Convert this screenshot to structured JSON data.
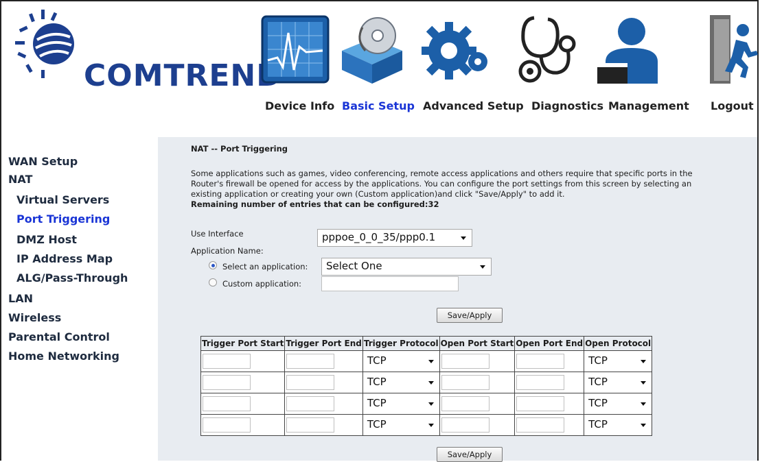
{
  "brand": {
    "name": "COMTREND"
  },
  "nav": {
    "items": [
      {
        "label": "Device Info",
        "icon": "device-info-icon"
      },
      {
        "label": "Basic Setup",
        "icon": "basic-setup-icon",
        "active": true
      },
      {
        "label": "Advanced Setup",
        "icon": "advanced-setup-icon"
      },
      {
        "label": "Diagnostics",
        "icon": "diagnostics-icon"
      },
      {
        "label": "Management",
        "icon": "management-icon"
      },
      {
        "label": "Logout",
        "icon": "logout-icon"
      }
    ]
  },
  "sidebar": {
    "items": [
      {
        "label": "WAN Setup"
      },
      {
        "label": "NAT"
      },
      {
        "label": "Virtual Servers"
      },
      {
        "label": "Port Triggering",
        "active": true
      },
      {
        "label": "DMZ Host"
      },
      {
        "label": "IP Address Map"
      },
      {
        "label": "ALG/Pass-Through"
      },
      {
        "label": "LAN"
      },
      {
        "label": "Wireless"
      },
      {
        "label": "Parental Control"
      },
      {
        "label": "Home Networking"
      }
    ]
  },
  "page": {
    "title": "NAT -- Port Triggering",
    "desc_line1": "Some applications such as games, video conferencing, remote access applications and others require that specific ports in the",
    "desc_line2": "Router's firewall be opened for access by the applications. You can configure the port settings from this screen by selecting an",
    "desc_line3": "existing application or creating your own (Custom application)and click \"Save/Apply\" to add it.",
    "remaining": "Remaining number of entries that can be configured:32",
    "use_interface_label": "Use Interface",
    "use_interface_value": "pppoe_0_0_35/ppp0.1",
    "app_name_label": "Application Name:",
    "select_app_label": "Select an application:",
    "select_app_value": "Select One",
    "custom_app_label": "Custom application:",
    "custom_app_value": "",
    "save_label": "Save/Apply"
  },
  "table": {
    "headers": [
      "Trigger Port Start",
      "Trigger Port End",
      "Trigger Protocol",
      "Open Port Start",
      "Open Port End",
      "Open Protocol"
    ],
    "rows": [
      {
        "trigger_protocol": "TCP",
        "open_protocol": "TCP"
      },
      {
        "trigger_protocol": "TCP",
        "open_protocol": "TCP"
      },
      {
        "trigger_protocol": "TCP",
        "open_protocol": "TCP"
      },
      {
        "trigger_protocol": "TCP",
        "open_protocol": "TCP"
      }
    ]
  },
  "colors": {
    "brand_blue": "#1d3f8f",
    "active_link": "#1a35d6",
    "content_bg": "#e8ecf1"
  }
}
